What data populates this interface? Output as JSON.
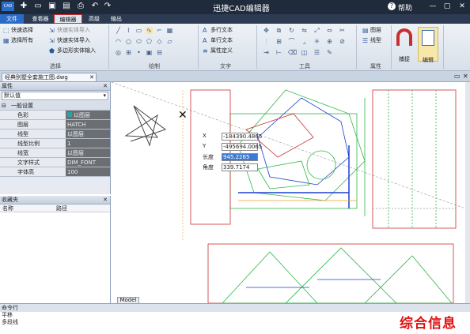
{
  "titlebar": {
    "logo": "CAD",
    "title": "迅捷CAD编辑器",
    "help": "帮助",
    "bg_color": "#1f2a3a"
  },
  "tabs": [
    "文件",
    "查看器",
    "编辑器",
    "高级",
    "输出"
  ],
  "active_tab": "编辑器",
  "ribbon": {
    "select_group": {
      "label": "选择",
      "items": [
        "快速选择",
        "选择所有",
        "快速实体导入",
        "快速实体导入",
        "多边形实体输入"
      ]
    },
    "draw_group": {
      "label": "绘制"
    },
    "text_group": {
      "label": "文字",
      "items": [
        "多行文本",
        "单行文本",
        "属性定义"
      ]
    },
    "tools_group": {
      "label": "工具"
    },
    "props_group": {
      "label": "属性",
      "items": [
        "图层",
        "线型"
      ]
    },
    "big_buttons": [
      "捕捉",
      "编辑"
    ]
  },
  "document": {
    "tab_label": "经典别墅全套施工图.dwg"
  },
  "properties_panel": {
    "header": "属性",
    "combo_value": "默认值",
    "section": "一般设置",
    "rows": [
      {
        "key": "色彩",
        "value": "以图层"
      },
      {
        "key": "图层",
        "value": "HATCH"
      },
      {
        "key": "线型",
        "value": "以图层"
      },
      {
        "key": "线型比例",
        "value": "1"
      },
      {
        "key": "线宽",
        "value": "以图层"
      },
      {
        "key": "文字样式",
        "value": "DIM_FONT"
      },
      {
        "key": "字体高",
        "value": "100"
      }
    ]
  },
  "favorites_panel": {
    "header": "收藏夹",
    "columns": [
      "名称",
      "路径"
    ]
  },
  "coordinate_input": {
    "rows": [
      {
        "label": "X",
        "value": "-184390.4865"
      },
      {
        "label": "Y",
        "value": "-495694.0065"
      },
      {
        "label": "长度",
        "value": "945.2265"
      },
      {
        "label": "角度",
        "value": "339.7174"
      }
    ]
  },
  "canvas": {
    "model_tab": "Model"
  },
  "command_line": {
    "header": "命令行",
    "lines": [
      "平移",
      "多段线"
    ]
  },
  "watermark": "综合信息",
  "colors": {
    "accent": "#2a6cc7",
    "highlight_border": "#cc2a2a",
    "prop_value_bg": "#6b6f73",
    "drawing_green": "#2db84a",
    "drawing_blue": "#1d3fd0",
    "drawing_red": "#c83232"
  }
}
